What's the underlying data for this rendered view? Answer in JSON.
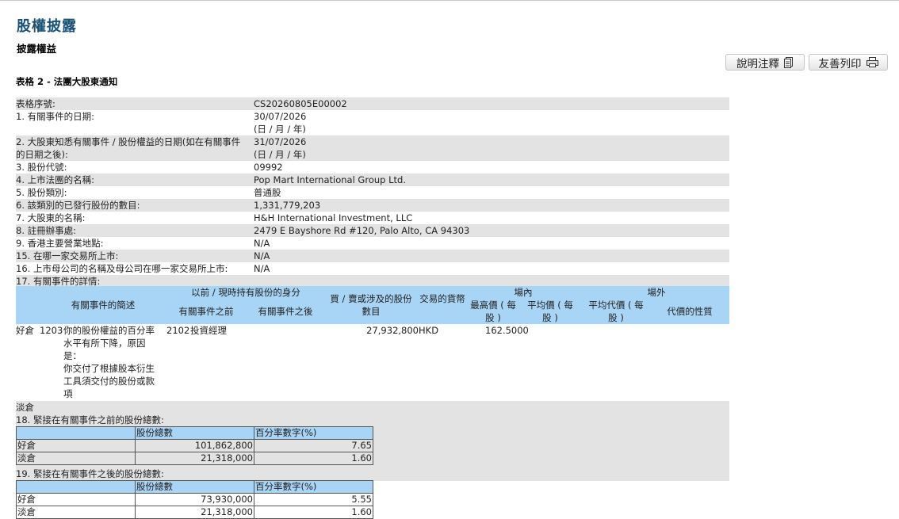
{
  "header": {
    "title": "股權披露",
    "subtitle": "披露權益",
    "section": "表格 2 - 法團大股東通知"
  },
  "buttons": {
    "notes_label": "說明注釋",
    "print_label": "友善列印"
  },
  "info_rows": [
    {
      "label": "表格序號:",
      "value": "CS20260805E00002"
    },
    {
      "label": "1. 有關事件的日期:",
      "value": "30/07/2026",
      "note": "(日 / 月 / 年)"
    },
    {
      "label": "2. 大股東知悉有關事件 / 股份權益的日期(如在有關事件",
      "label2": "的日期之後):",
      "value": "31/07/2026",
      "note": "(日 / 月 / 年)"
    },
    {
      "label": "3. 股份代號:",
      "value": "09992"
    },
    {
      "label": "4. 上市法團的名稱:",
      "value": "Pop Mart International Group Ltd."
    },
    {
      "label": "5. 股份類別:",
      "value": "普通股"
    },
    {
      "label": "6. 該類別的已發行股份的數目:",
      "value": "1,331,779,203"
    },
    {
      "label": "7. 大股東的名稱:",
      "value": "H&H International Investment, LLC"
    },
    {
      "label": "8. 註冊辦事處:",
      "value": "2479 E Bayshore Rd #120, Palo Alto, CA 94303"
    },
    {
      "label": "9. 香港主要營業地點:",
      "value": "N/A"
    },
    {
      "label": "15. 在哪一家交易所上市:",
      "value": "N/A"
    },
    {
      "label": "16. 上市母公司的名稱及母公司在哪一家交易所上市:",
      "value": "N/A"
    },
    {
      "label": "17. 有關事件的詳情:",
      "value": ""
    }
  ],
  "details": {
    "headers": {
      "event_desc": "有關事件的簡述",
      "capacity_group": "以前 / 現時持有股份的身分",
      "before": "有關事件之前",
      "after": "有關事件之後",
      "shares": "買 / 賣或涉及的股份數目",
      "currency": "交易的貨幣",
      "onex": "場內",
      "high": "最高價 ( 每股 )",
      "avg": "平均價 ( 每股 )",
      "offex": "場外",
      "offavg": "平均代價 ( 每股 )",
      "nature": "代價的性質"
    },
    "row": {
      "position": "好倉",
      "code": "1203",
      "desc": [
        "你的股份權益的百分率",
        "水平有所下降，原因",
        "是：",
        "你交付了根據股本衍生",
        "工具須交付的股份或款",
        "項"
      ],
      "capacity_code": "2102",
      "capacity": "投資經理",
      "shares": "27,932,800",
      "currency": "HKD",
      "high": "162.5000"
    },
    "short_label": "淡倉"
  },
  "q18": {
    "title": "18. 緊接在有關事件之前的股份總數:",
    "col_shares": "股份總數",
    "col_pct": "百分率數字(%)",
    "rows": [
      {
        "type": "好倉",
        "shares": "101,862,800",
        "pct": "7.65"
      },
      {
        "type": "淡倉",
        "shares": "21,318,000",
        "pct": "1.60"
      }
    ]
  },
  "q19": {
    "title": "19. 緊接在有關事件之後的股份總數:",
    "col_shares": "股份總數",
    "col_pct": "百分率數字(%)",
    "rows": [
      {
        "type": "好倉",
        "shares": "73,930,000",
        "pct": "5.55"
      },
      {
        "type": "淡倉",
        "shares": "21,318,000",
        "pct": "1.60"
      }
    ]
  }
}
